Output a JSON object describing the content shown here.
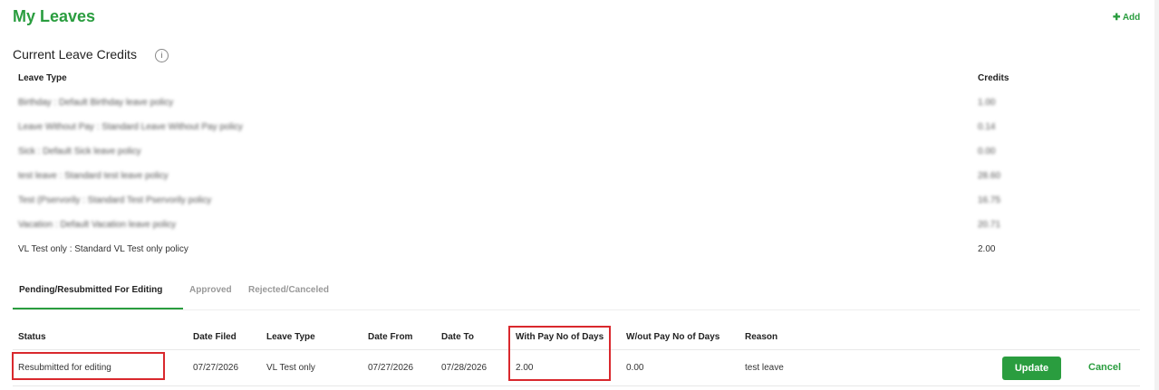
{
  "page": {
    "title": "My Leaves",
    "add_label": "Add"
  },
  "credits": {
    "title": "Current Leave Credits",
    "info_glyph": "i",
    "col_leave_type": "Leave Type",
    "col_credits": "Credits",
    "rows": [
      {
        "type": "Birthday : Default Birthday leave policy",
        "credits": "1.00",
        "blurred": true
      },
      {
        "type": "Leave Without Pay : Standard Leave Without Pay policy",
        "credits": "0.14",
        "blurred": true
      },
      {
        "type": "Sick : Default Sick leave policy",
        "credits": "0.00",
        "blurred": true
      },
      {
        "type": "test leave : Standard test leave policy",
        "credits": "28.60",
        "blurred": true
      },
      {
        "type": "Test (Pservorily : Standard Test Pservorily policy",
        "credits": "16.75",
        "blurred": true
      },
      {
        "type": "Vacation : Default Vacation leave policy",
        "credits": "20.71",
        "blurred": true
      },
      {
        "type": "VL Test only : Standard VL Test only policy",
        "credits": "2.00",
        "blurred": false
      }
    ]
  },
  "tabs": [
    {
      "label": "Pending/Resubmitted For Editing",
      "active": true
    },
    {
      "label": "Approved",
      "active": false
    },
    {
      "label": "Rejected/Canceled",
      "active": false
    }
  ],
  "requests": {
    "columns": {
      "status": "Status",
      "date_filed": "Date Filed",
      "leave_type": "Leave Type",
      "date_from": "Date From",
      "date_to": "Date To",
      "with_pay": "With Pay No of Days",
      "without_pay": "W/out Pay No of Days",
      "reason": "Reason"
    },
    "row": {
      "status": "Resubmitted for editing",
      "date_filed": "07/27/2026",
      "leave_type": "VL Test only",
      "date_from": "07/27/2026",
      "date_to": "07/28/2026",
      "with_pay": "2.00",
      "without_pay": "0.00",
      "reason": "test leave",
      "update_label": "Update",
      "cancel_label": "Cancel"
    }
  },
  "colors": {
    "accent": "#2a9d3f",
    "highlight": "#d9282d"
  }
}
